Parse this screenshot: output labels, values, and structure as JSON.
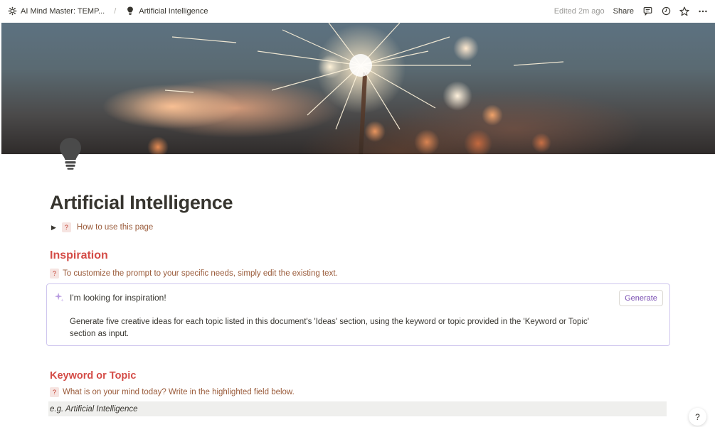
{
  "breadcrumb": {
    "workspace": "AI Mind Master: TEMP...",
    "separator": "/",
    "page": "Artificial Intelligence"
  },
  "topbar": {
    "edited": "Edited 2m ago",
    "share": "Share",
    "icons": [
      "comment-icon",
      "clock-icon",
      "star-icon",
      "more-icon"
    ]
  },
  "page": {
    "title": "Artificial Intelligence",
    "icon": "lightbulb-icon"
  },
  "toggle": {
    "badge": "?",
    "label": "How to use this page"
  },
  "inspiration": {
    "heading": "Inspiration",
    "hint_badge": "?",
    "hint": "To customize the prompt to your specific needs, simply edit the existing text.",
    "block": {
      "title": "I'm looking for inspiration!",
      "body": "Generate five creative ideas for each topic listed in this document's 'Ideas' section, using the keyword or topic provided in the 'Keyword or Topic' section as input.",
      "button": "Generate"
    }
  },
  "keyword": {
    "heading": "Keyword or Topic",
    "hint_badge": "?",
    "hint": "What is on your mind today? Write in the highlighted field below.",
    "field": "e.g. Artificial Intelligence"
  },
  "help": "?",
  "colors": {
    "heading_red": "#d44c47",
    "hint_brown": "#9a5b3a",
    "ai_border": "#cfc6ee",
    "generate_purple": "#7a4fb2"
  }
}
